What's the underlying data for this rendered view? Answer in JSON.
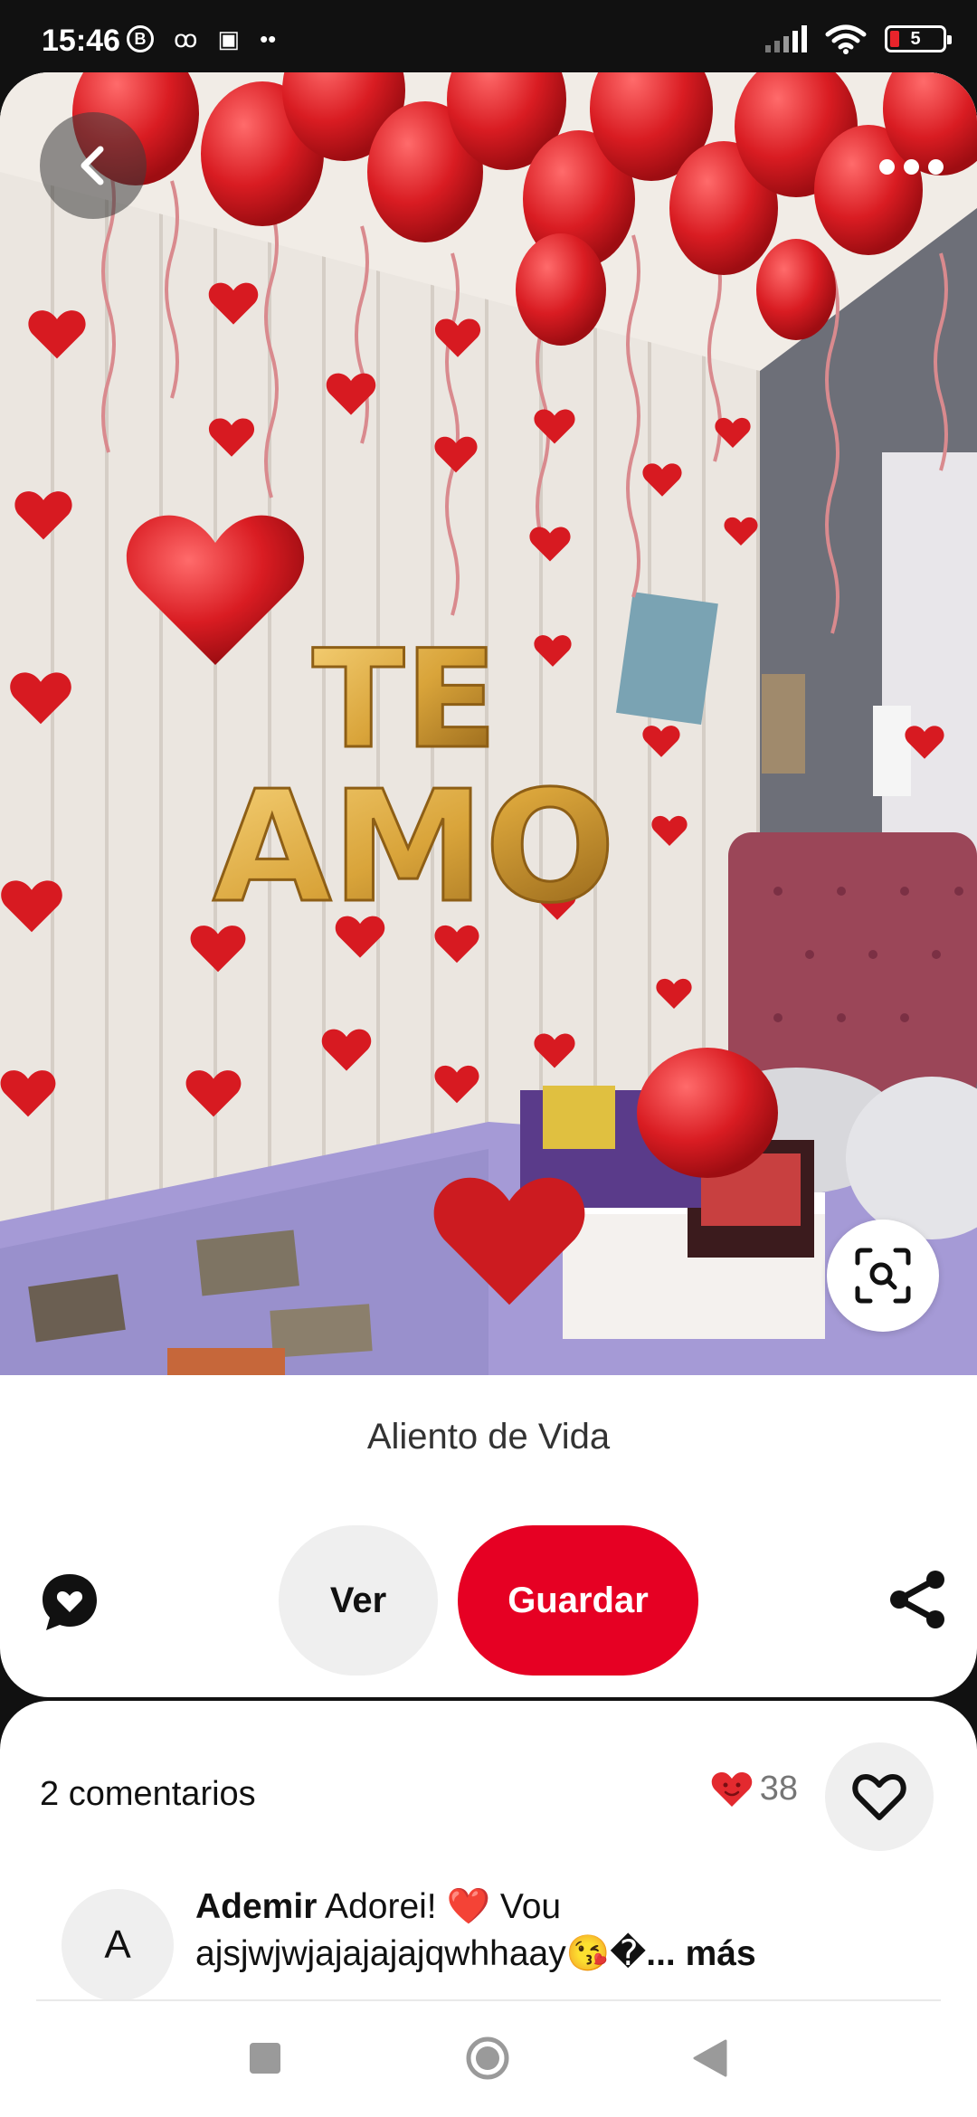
{
  "status_bar": {
    "time": "15:46",
    "left_icons": [
      "b-circle-icon",
      "voicemail-icon",
      "battery-saver-icon",
      "more-dots-icon"
    ],
    "b_label": "B",
    "voicemail_glyph": "ꝏ",
    "saver_glyph": "▣",
    "dots_glyph": "••",
    "right_icons": [
      "signal-icon",
      "wifi-icon",
      "battery-icon"
    ],
    "battery_level": "5"
  },
  "pin": {
    "image_description_icon": "photo-image",
    "letters_top": "TE",
    "letters_bottom": "AMO",
    "source_title": "Aliento de Vida",
    "actions": {
      "view_label": "Ver",
      "save_label": "Guardar"
    },
    "colors": {
      "save_red": "#e60023",
      "heart_red": "#d71a21",
      "gold": "#d9a43a",
      "wall": "#e9e4df",
      "bed": "#a59ad6"
    }
  },
  "comments": {
    "count_label": "2 comentarios",
    "reaction_count": "38",
    "items": [
      {
        "avatar_initial": "A",
        "author": "Ademir",
        "text_line1": " Adorei! ❤️ Vou",
        "text_line2": "ajsjwjwjajajajajqwhhaay😘�",
        "more_label": "... más"
      }
    ]
  },
  "nav": {
    "icons": [
      "recent-apps-icon",
      "home-icon",
      "back-triangle-icon"
    ]
  }
}
